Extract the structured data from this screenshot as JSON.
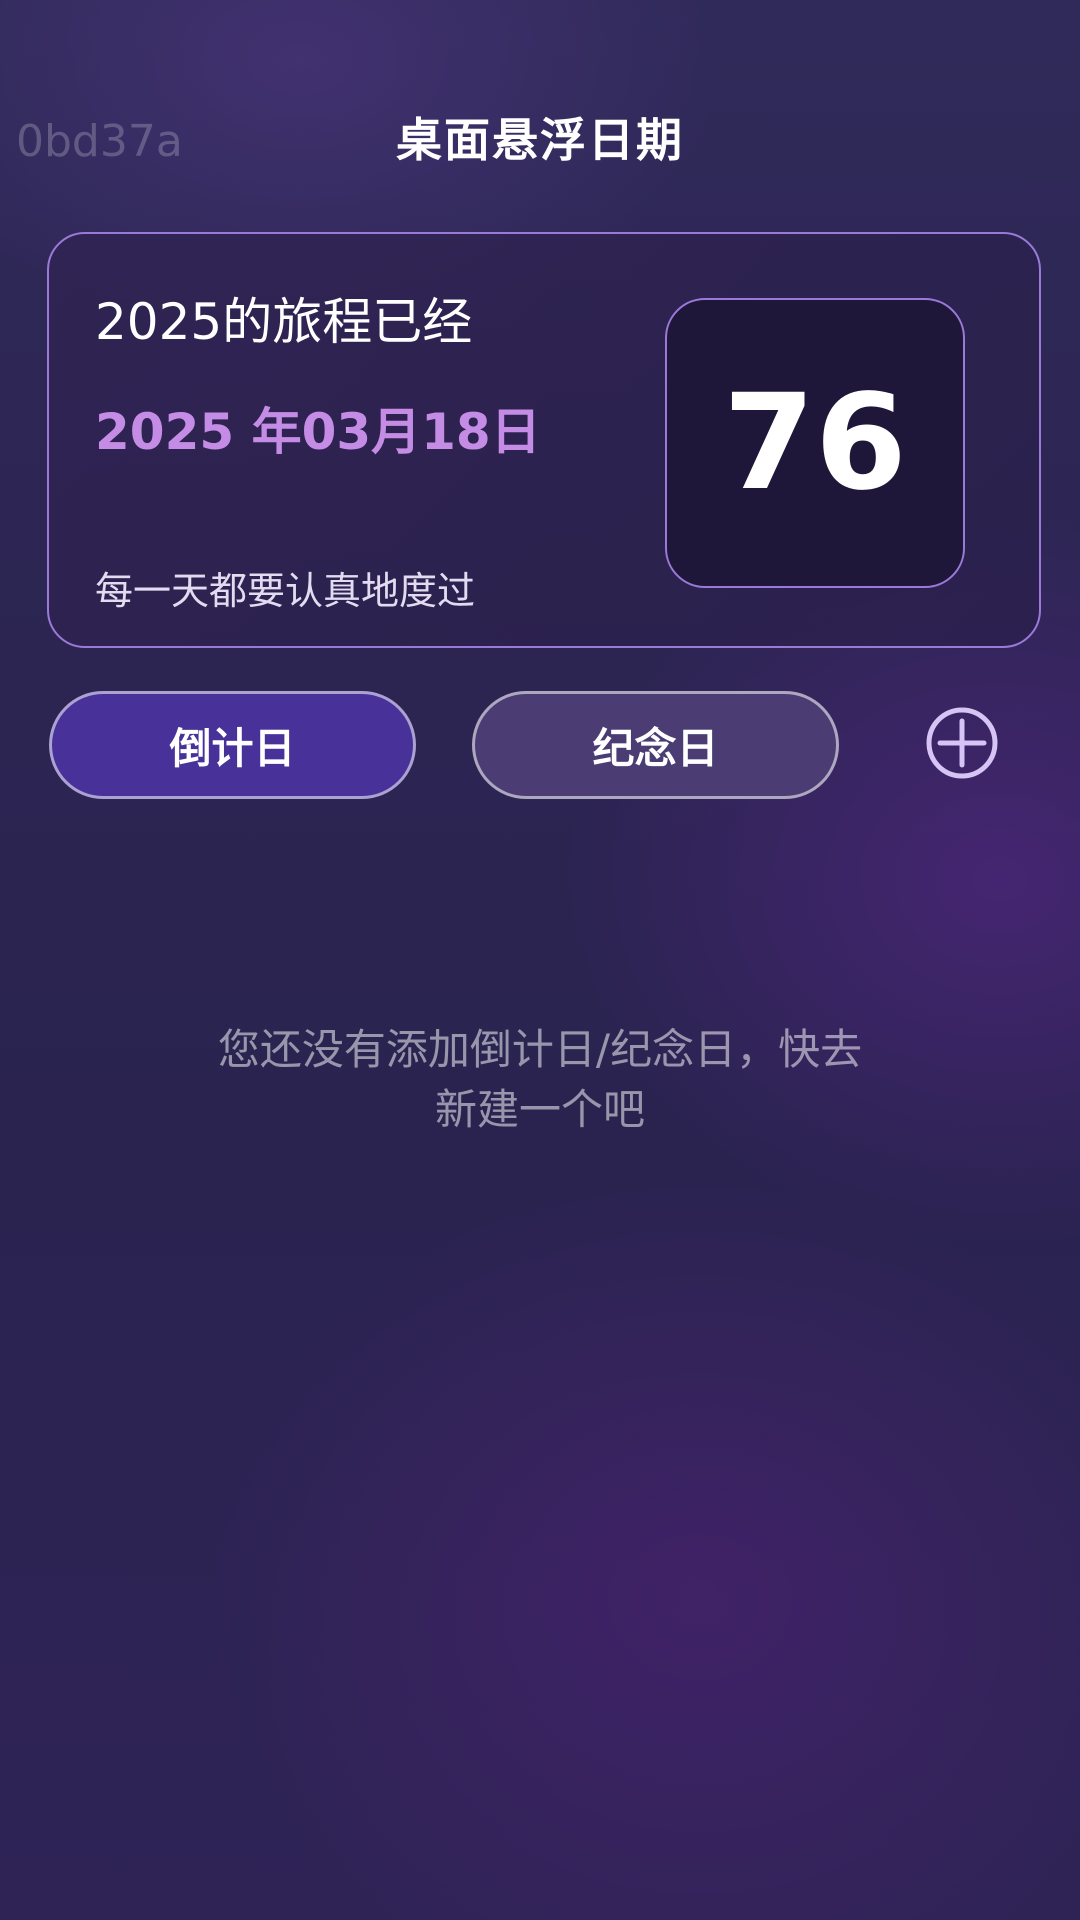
{
  "watermark": "0bd37a",
  "header": {
    "title": "桌面悬浮日期"
  },
  "summary_card": {
    "headline": "2025的旅程已经",
    "date": "2025 年03月18日",
    "motto": "每一天都要认真地度过",
    "days_count": "76"
  },
  "tabs": [
    {
      "label": "倒计日",
      "selected": true
    },
    {
      "label": "纪念日",
      "selected": false
    }
  ],
  "add_button": {
    "icon": "plus-circle-icon"
  },
  "empty_state": {
    "line1": "您还没有添加倒计日/纪念日，快去",
    "line2": "新建一个吧"
  },
  "colors": {
    "accent_purple": "#9b79d8",
    "date_text": "#c48ce4",
    "tab_selected": "#48329a",
    "tab_unselected": "#4b3d74"
  }
}
